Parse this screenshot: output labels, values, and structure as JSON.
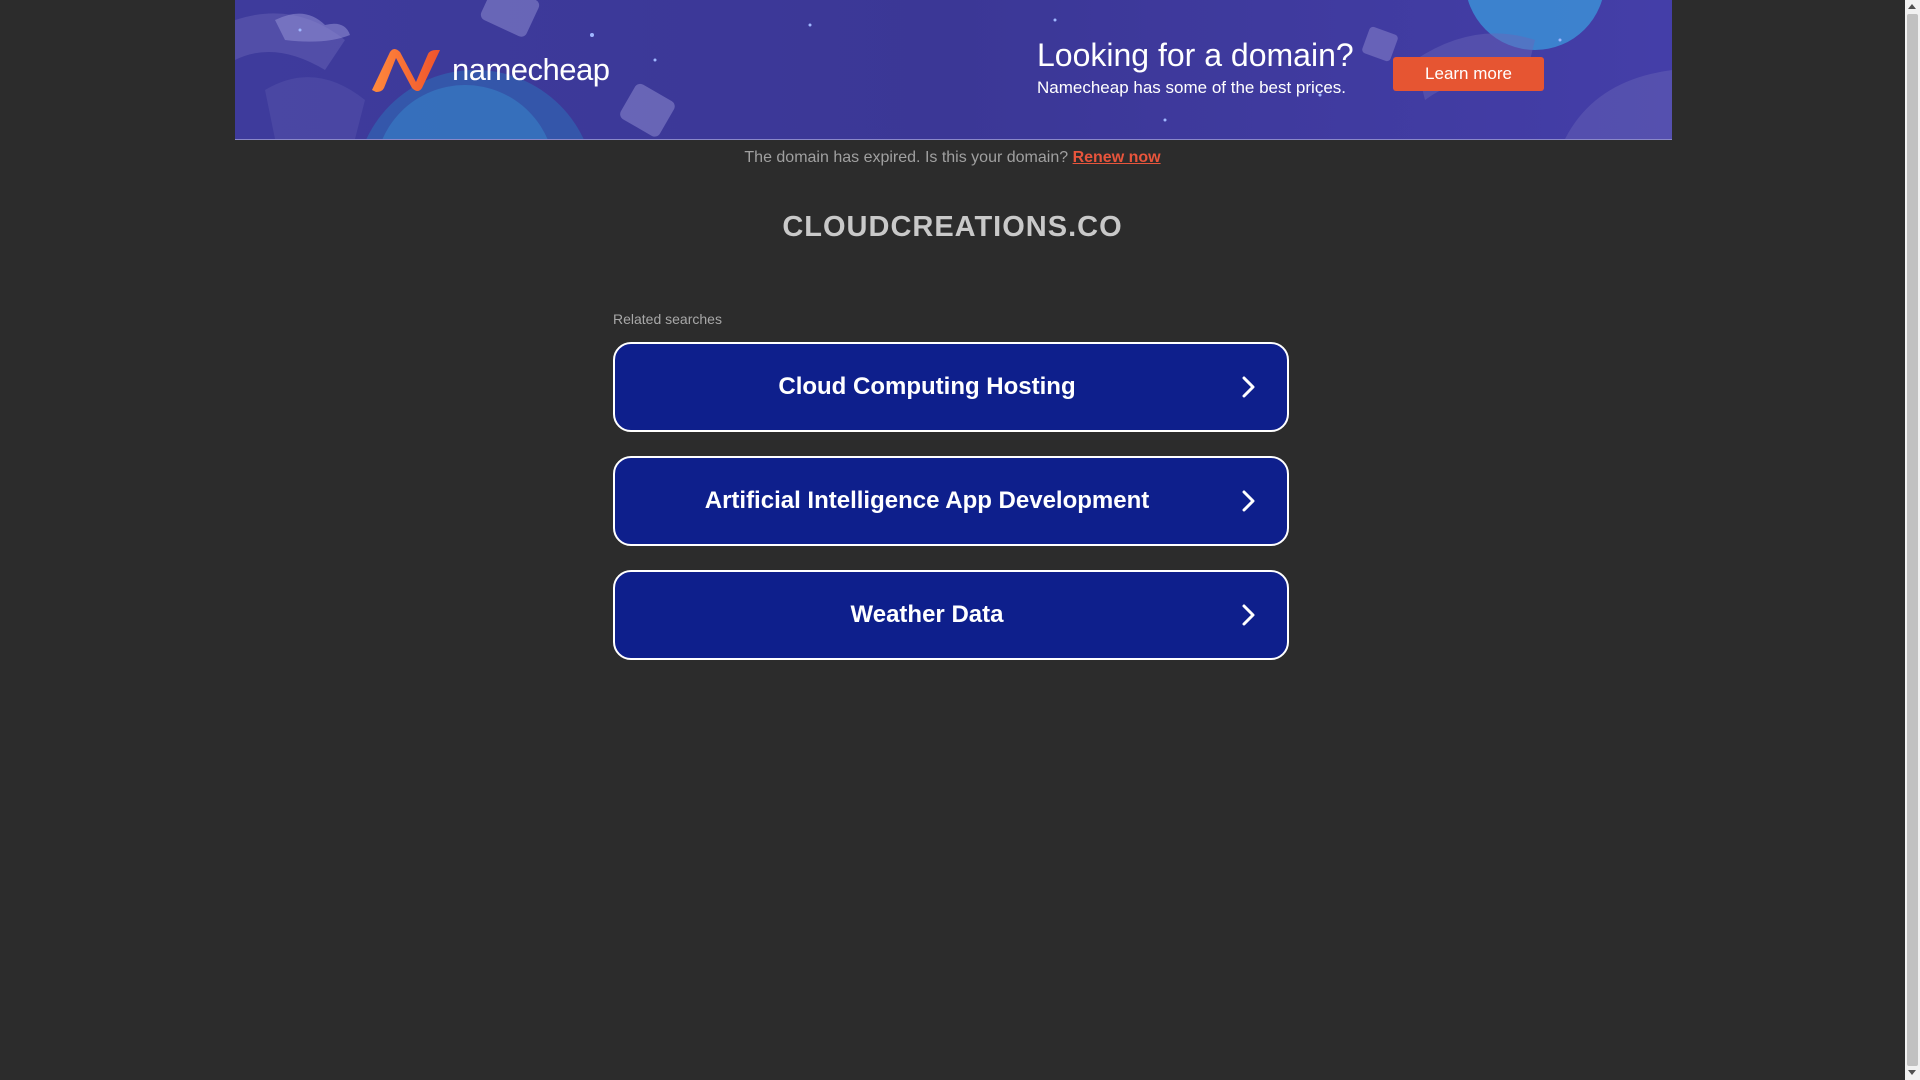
{
  "banner": {
    "logo_text": "namecheap",
    "title": "Looking for a domain?",
    "subtitle": "Namecheap has some of the best prices.",
    "cta_label": "Learn more"
  },
  "notice": {
    "text": "The domain has expired. Is this your domain?",
    "link_label": "Renew now"
  },
  "domain_name": "CLOUDCREATIONS.CO",
  "related": {
    "label": "Related searches",
    "items": [
      {
        "label": "Cloud Computing Hosting"
      },
      {
        "label": "Artificial Intelligence App Development"
      },
      {
        "label": "Weather Data"
      }
    ]
  },
  "colors": {
    "accent": "#e65532",
    "button_bg": "#0e1f8c",
    "page_bg": "#2c2c2c"
  }
}
